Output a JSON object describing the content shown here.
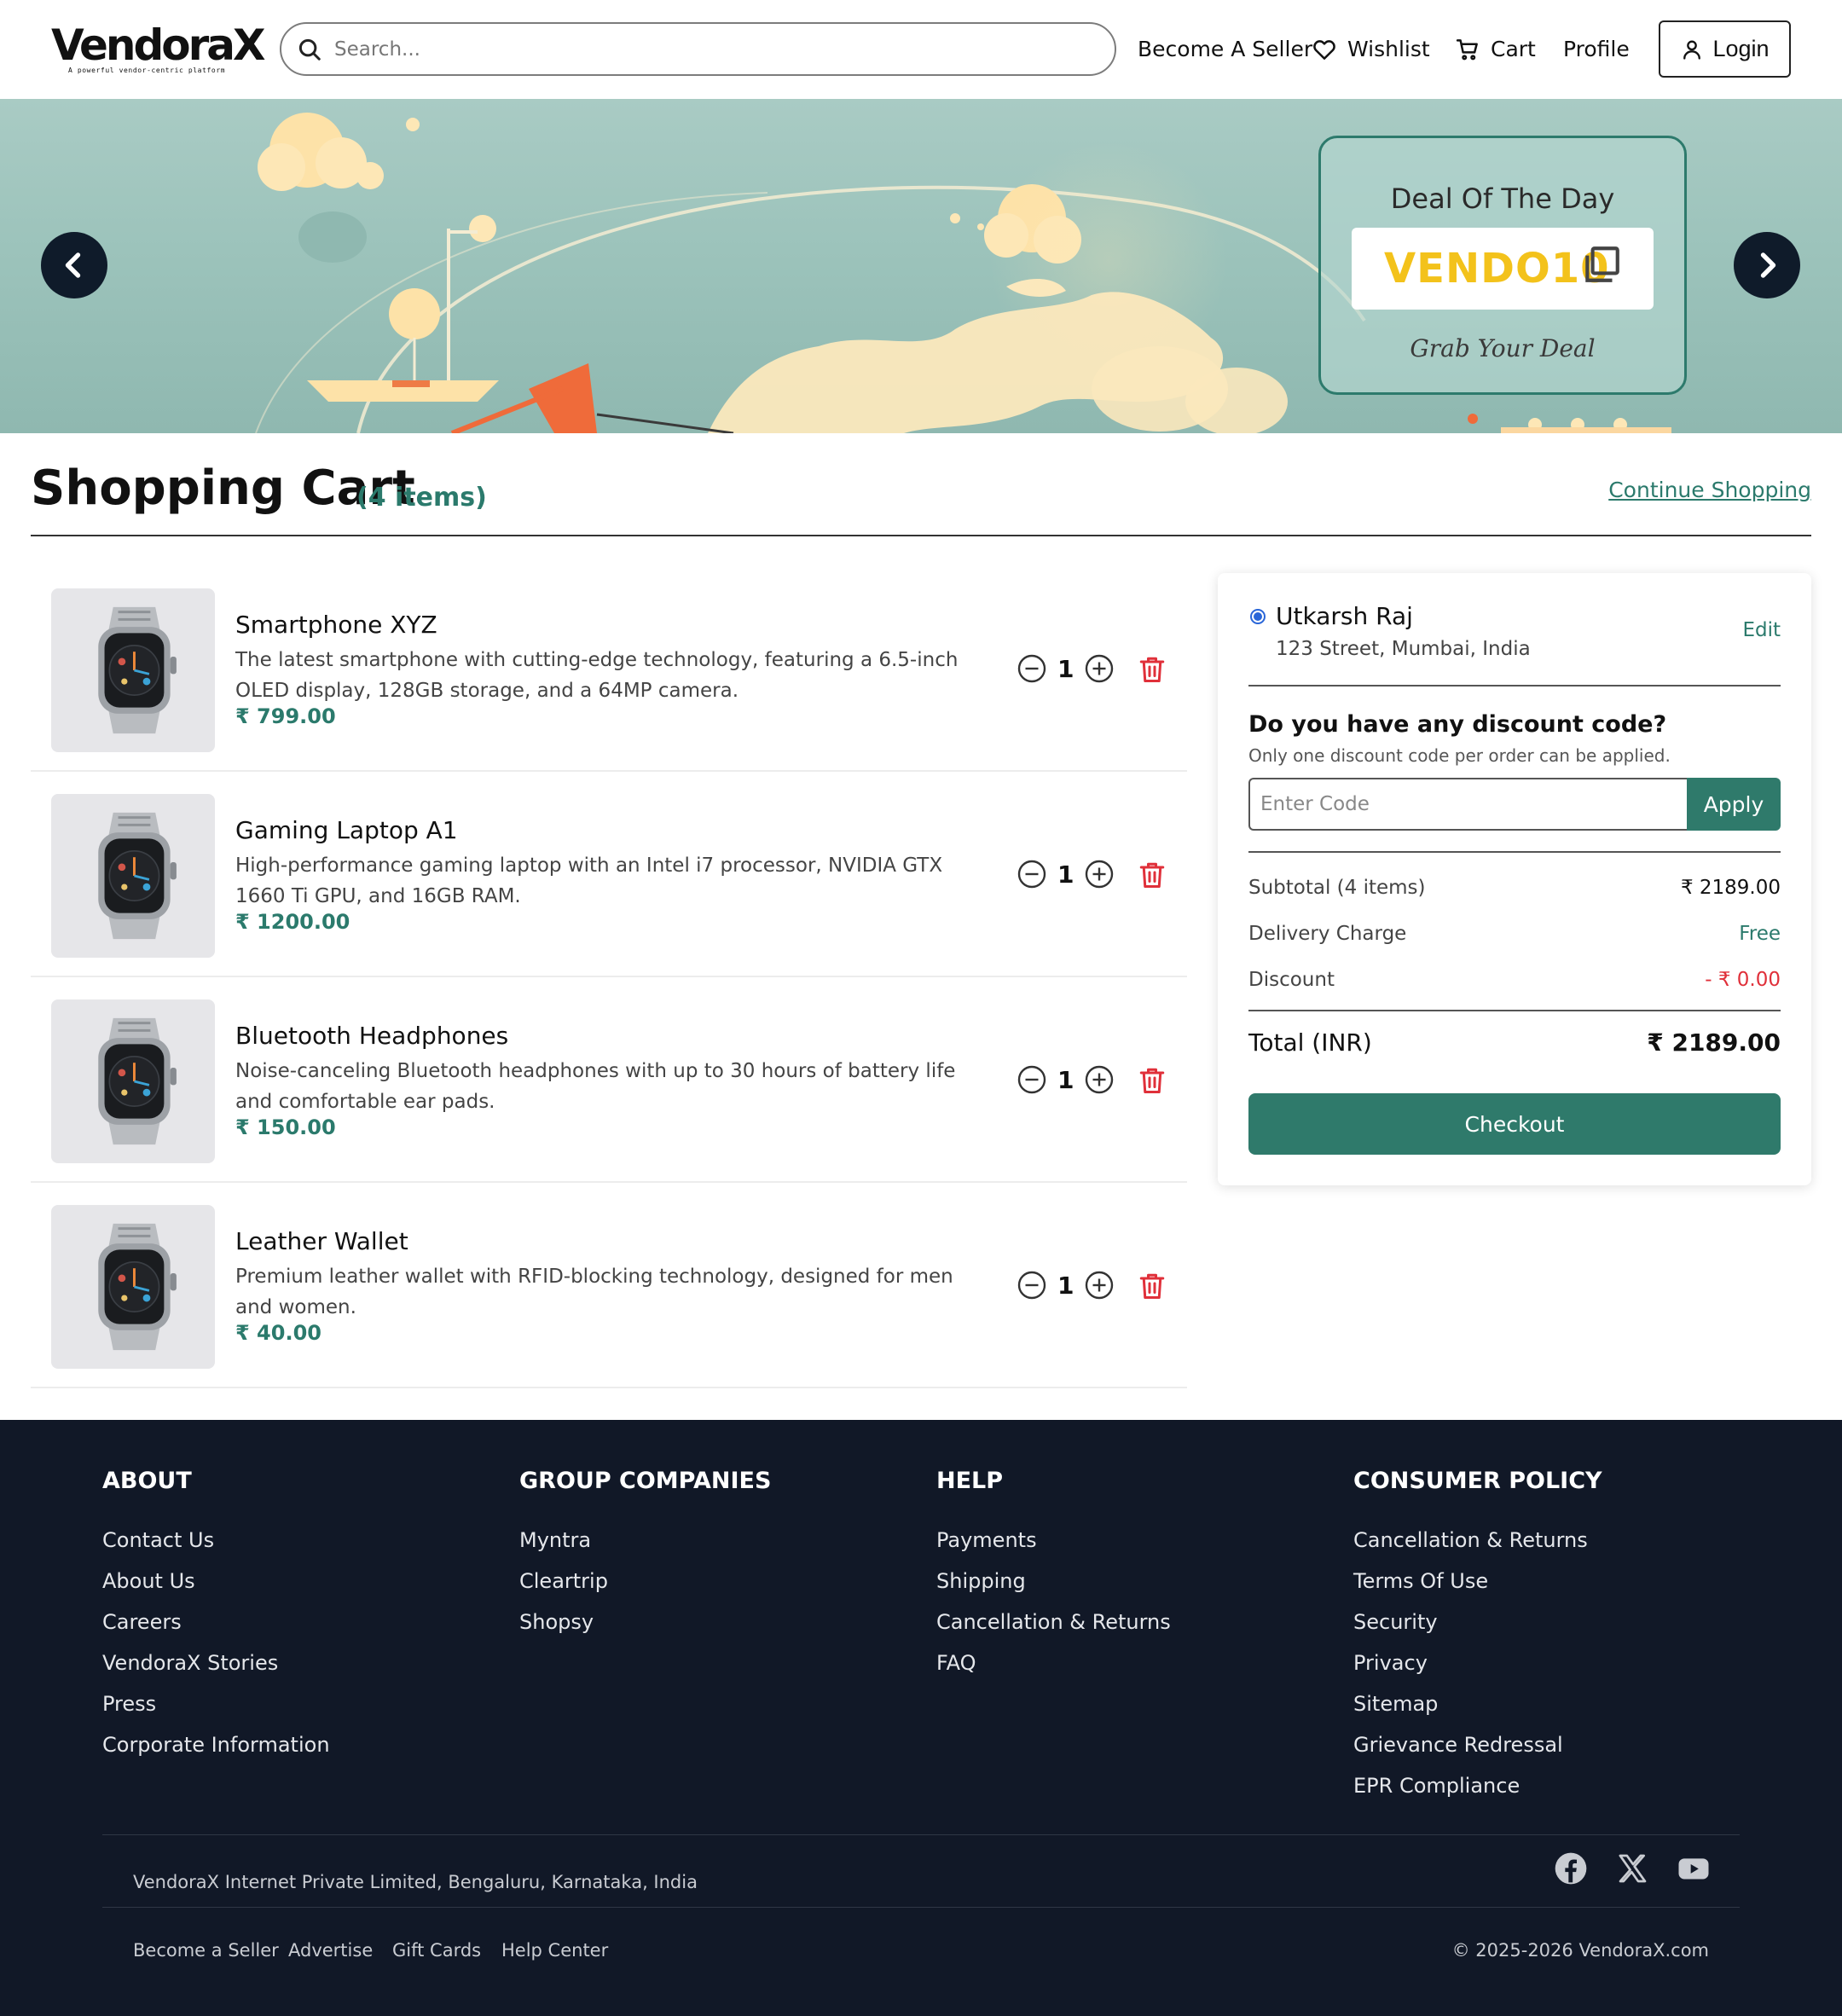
{
  "header": {
    "logo_text": "VendoraX",
    "logo_tagline": "A powerful vendor-centric platform",
    "search_placeholder": "Search...",
    "nav": {
      "become_seller": "Become A Seller",
      "wishlist": "Wishlist",
      "cart": "Cart",
      "profile": "Profile"
    },
    "login_label": "Login"
  },
  "banner": {
    "deal_title": "Deal Of The Day",
    "deal_code": "VENDO10",
    "deal_subtitle": "Grab Your Deal"
  },
  "cart": {
    "title": "Shopping Cart",
    "item_count_label": "(4 items)",
    "continue_label": "Continue Shopping",
    "items": [
      {
        "name": "Smartphone XYZ",
        "description": "The latest smartphone with cutting-edge technology, featuring a 6.5-inch OLED display, 128GB storage, and a 64MP camera.",
        "price": "₹ 799.00",
        "quantity": "1"
      },
      {
        "name": "Gaming Laptop A1",
        "description": "High-performance gaming laptop with an Intel i7 processor, NVIDIA GTX 1660 Ti GPU, and 16GB RAM.",
        "price": "₹ 1200.00",
        "quantity": "1"
      },
      {
        "name": "Bluetooth Headphones",
        "description": "Noise-canceling Bluetooth headphones with up to 30 hours of battery life and comfortable ear pads.",
        "price": "₹ 150.00",
        "quantity": "1"
      },
      {
        "name": "Leather Wallet",
        "description": "Premium leather wallet with RFID-blocking technology, designed for men and women.",
        "price": "₹ 40.00",
        "quantity": "1"
      }
    ]
  },
  "summary": {
    "address_name": "Utkarsh Raj",
    "address_line": "123 Street, Mumbai, India",
    "edit_label": "Edit",
    "discount_title": "Do you have any discount code?",
    "discount_subtitle": "Only one discount code per order can be applied.",
    "code_placeholder": "Enter Code",
    "apply_label": "Apply",
    "subtotal_label": "Subtotal (4 items)",
    "subtotal_value": "₹ 2189.00",
    "delivery_label": "Delivery Charge",
    "delivery_value": "Free",
    "discount_label": "Discount",
    "discount_value": "- ₹ 0.00",
    "total_label": "Total (INR)",
    "total_value": "₹ 2189.00",
    "checkout_label": "Checkout"
  },
  "footer": {
    "columns": [
      {
        "heading": "ABOUT",
        "links": [
          "Contact Us",
          "About Us",
          "Careers",
          "VendoraX Stories",
          "Press",
          "Corporate Information"
        ]
      },
      {
        "heading": "GROUP COMPANIES",
        "links": [
          "Myntra",
          "Cleartrip",
          "Shopsy"
        ]
      },
      {
        "heading": "HELP",
        "links": [
          "Payments",
          "Shipping",
          "Cancellation & Returns",
          "FAQ"
        ]
      },
      {
        "heading": "CONSUMER POLICY",
        "links": [
          "Cancellation & Returns",
          "Terms Of Use",
          "Security",
          "Privacy",
          "Sitemap",
          "Grievance Redressal",
          "EPR Compliance"
        ]
      }
    ],
    "address": "VendoraX Internet Private Limited, Bengaluru, Karnataka, India",
    "social_icons": [
      "facebook-icon",
      "x-icon",
      "youtube-icon"
    ],
    "bottom_links": [
      "Become a Seller",
      "Advertise",
      "Gift Cards",
      "Help Center"
    ],
    "copyright": "© 2025-2026 VendoraX.com"
  },
  "colors": {
    "accent": "#2f7a6b",
    "deal_code": "#f3c21b",
    "discount_negative": "#e0303a",
    "footer_bg": "#111827",
    "banner_bg": "#9cc3bb"
  }
}
